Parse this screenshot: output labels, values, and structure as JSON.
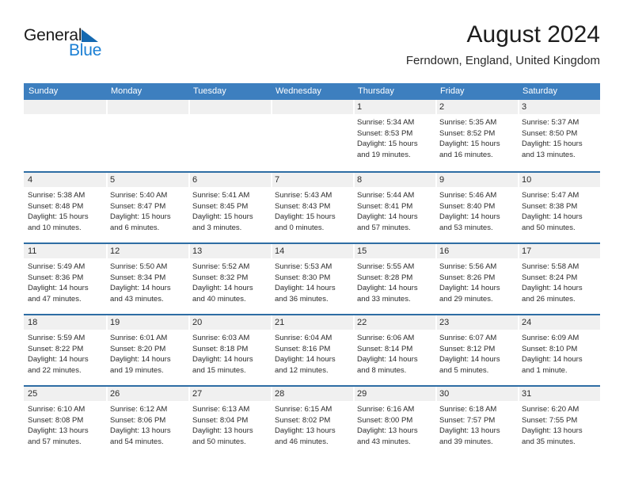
{
  "brand": {
    "name_part1": "General",
    "name_part2": "Blue",
    "triangle_icon": "triangle-icon",
    "color_dark": "#1a1a1a",
    "color_blue": "#1a7fd4",
    "accent": "#1569b0"
  },
  "header": {
    "title": "August 2024",
    "location": "Ferndown, England, United Kingdom"
  },
  "theme": {
    "header_bar": "#3d7fbf",
    "week_divider": "#2e6da4",
    "date_band": "#f0f0f0",
    "text": "#2b2b2b"
  },
  "calendar": {
    "weekday_headers": [
      "Sunday",
      "Monday",
      "Tuesday",
      "Wednesday",
      "Thursday",
      "Friday",
      "Saturday"
    ],
    "weeks": [
      [
        {
          "day": "",
          "lines": []
        },
        {
          "day": "",
          "lines": []
        },
        {
          "day": "",
          "lines": []
        },
        {
          "day": "",
          "lines": []
        },
        {
          "day": "1",
          "lines": [
            "Sunrise: 5:34 AM",
            "Sunset: 8:53 PM",
            "Daylight: 15 hours",
            "and 19 minutes."
          ]
        },
        {
          "day": "2",
          "lines": [
            "Sunrise: 5:35 AM",
            "Sunset: 8:52 PM",
            "Daylight: 15 hours",
            "and 16 minutes."
          ]
        },
        {
          "day": "3",
          "lines": [
            "Sunrise: 5:37 AM",
            "Sunset: 8:50 PM",
            "Daylight: 15 hours",
            "and 13 minutes."
          ]
        }
      ],
      [
        {
          "day": "4",
          "lines": [
            "Sunrise: 5:38 AM",
            "Sunset: 8:48 PM",
            "Daylight: 15 hours",
            "and 10 minutes."
          ]
        },
        {
          "day": "5",
          "lines": [
            "Sunrise: 5:40 AM",
            "Sunset: 8:47 PM",
            "Daylight: 15 hours",
            "and 6 minutes."
          ]
        },
        {
          "day": "6",
          "lines": [
            "Sunrise: 5:41 AM",
            "Sunset: 8:45 PM",
            "Daylight: 15 hours",
            "and 3 minutes."
          ]
        },
        {
          "day": "7",
          "lines": [
            "Sunrise: 5:43 AM",
            "Sunset: 8:43 PM",
            "Daylight: 15 hours",
            "and 0 minutes."
          ]
        },
        {
          "day": "8",
          "lines": [
            "Sunrise: 5:44 AM",
            "Sunset: 8:41 PM",
            "Daylight: 14 hours",
            "and 57 minutes."
          ]
        },
        {
          "day": "9",
          "lines": [
            "Sunrise: 5:46 AM",
            "Sunset: 8:40 PM",
            "Daylight: 14 hours",
            "and 53 minutes."
          ]
        },
        {
          "day": "10",
          "lines": [
            "Sunrise: 5:47 AM",
            "Sunset: 8:38 PM",
            "Daylight: 14 hours",
            "and 50 minutes."
          ]
        }
      ],
      [
        {
          "day": "11",
          "lines": [
            "Sunrise: 5:49 AM",
            "Sunset: 8:36 PM",
            "Daylight: 14 hours",
            "and 47 minutes."
          ]
        },
        {
          "day": "12",
          "lines": [
            "Sunrise: 5:50 AM",
            "Sunset: 8:34 PM",
            "Daylight: 14 hours",
            "and 43 minutes."
          ]
        },
        {
          "day": "13",
          "lines": [
            "Sunrise: 5:52 AM",
            "Sunset: 8:32 PM",
            "Daylight: 14 hours",
            "and 40 minutes."
          ]
        },
        {
          "day": "14",
          "lines": [
            "Sunrise: 5:53 AM",
            "Sunset: 8:30 PM",
            "Daylight: 14 hours",
            "and 36 minutes."
          ]
        },
        {
          "day": "15",
          "lines": [
            "Sunrise: 5:55 AM",
            "Sunset: 8:28 PM",
            "Daylight: 14 hours",
            "and 33 minutes."
          ]
        },
        {
          "day": "16",
          "lines": [
            "Sunrise: 5:56 AM",
            "Sunset: 8:26 PM",
            "Daylight: 14 hours",
            "and 29 minutes."
          ]
        },
        {
          "day": "17",
          "lines": [
            "Sunrise: 5:58 AM",
            "Sunset: 8:24 PM",
            "Daylight: 14 hours",
            "and 26 minutes."
          ]
        }
      ],
      [
        {
          "day": "18",
          "lines": [
            "Sunrise: 5:59 AM",
            "Sunset: 8:22 PM",
            "Daylight: 14 hours",
            "and 22 minutes."
          ]
        },
        {
          "day": "19",
          "lines": [
            "Sunrise: 6:01 AM",
            "Sunset: 8:20 PM",
            "Daylight: 14 hours",
            "and 19 minutes."
          ]
        },
        {
          "day": "20",
          "lines": [
            "Sunrise: 6:03 AM",
            "Sunset: 8:18 PM",
            "Daylight: 14 hours",
            "and 15 minutes."
          ]
        },
        {
          "day": "21",
          "lines": [
            "Sunrise: 6:04 AM",
            "Sunset: 8:16 PM",
            "Daylight: 14 hours",
            "and 12 minutes."
          ]
        },
        {
          "day": "22",
          "lines": [
            "Sunrise: 6:06 AM",
            "Sunset: 8:14 PM",
            "Daylight: 14 hours",
            "and 8 minutes."
          ]
        },
        {
          "day": "23",
          "lines": [
            "Sunrise: 6:07 AM",
            "Sunset: 8:12 PM",
            "Daylight: 14 hours",
            "and 5 minutes."
          ]
        },
        {
          "day": "24",
          "lines": [
            "Sunrise: 6:09 AM",
            "Sunset: 8:10 PM",
            "Daylight: 14 hours",
            "and 1 minute."
          ]
        }
      ],
      [
        {
          "day": "25",
          "lines": [
            "Sunrise: 6:10 AM",
            "Sunset: 8:08 PM",
            "Daylight: 13 hours",
            "and 57 minutes."
          ]
        },
        {
          "day": "26",
          "lines": [
            "Sunrise: 6:12 AM",
            "Sunset: 8:06 PM",
            "Daylight: 13 hours",
            "and 54 minutes."
          ]
        },
        {
          "day": "27",
          "lines": [
            "Sunrise: 6:13 AM",
            "Sunset: 8:04 PM",
            "Daylight: 13 hours",
            "and 50 minutes."
          ]
        },
        {
          "day": "28",
          "lines": [
            "Sunrise: 6:15 AM",
            "Sunset: 8:02 PM",
            "Daylight: 13 hours",
            "and 46 minutes."
          ]
        },
        {
          "day": "29",
          "lines": [
            "Sunrise: 6:16 AM",
            "Sunset: 8:00 PM",
            "Daylight: 13 hours",
            "and 43 minutes."
          ]
        },
        {
          "day": "30",
          "lines": [
            "Sunrise: 6:18 AM",
            "Sunset: 7:57 PM",
            "Daylight: 13 hours",
            "and 39 minutes."
          ]
        },
        {
          "day": "31",
          "lines": [
            "Sunrise: 6:20 AM",
            "Sunset: 7:55 PM",
            "Daylight: 13 hours",
            "and 35 minutes."
          ]
        }
      ]
    ]
  }
}
